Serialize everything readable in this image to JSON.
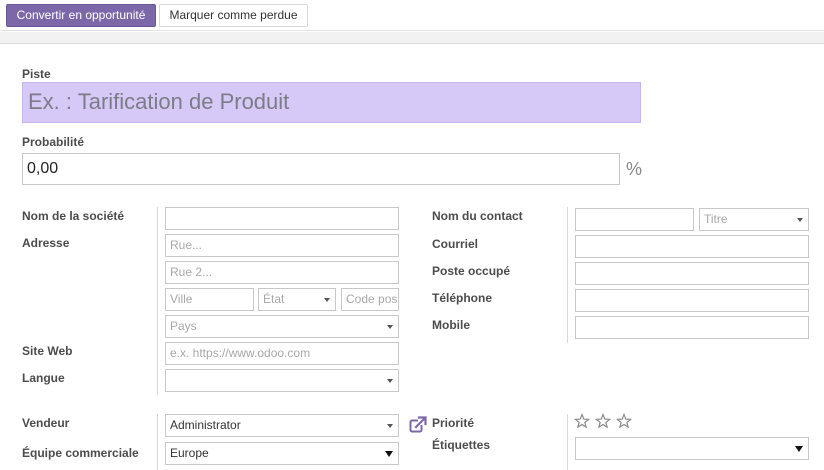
{
  "toolbar": {
    "convert_label": "Convertir en opportunité",
    "lost_label": "Marquer comme perdue"
  },
  "form": {
    "lead_label": "Piste",
    "lead_placeholder": "Ex. : Tarification de Produit",
    "probability_label": "Probabilité",
    "probability_value": "0,00",
    "percent_symbol": "%",
    "company_label": "Nom de la société",
    "company_value": "",
    "address_label": "Adresse",
    "street_placeholder": "Rue...",
    "street2_placeholder": "Rue 2...",
    "city_placeholder": "Ville",
    "state_placeholder": "État",
    "zip_placeholder": "Code pos",
    "country_placeholder": "Pays",
    "website_label": "Site Web",
    "website_placeholder": "e.x. https://www.odoo.com",
    "language_label": "Langue",
    "language_value": "",
    "contact_label": "Nom du contact",
    "contact_value": "",
    "title_placeholder": "Titre",
    "email_label": "Courriel",
    "job_label": "Poste occupé",
    "phone_label": "Téléphone",
    "mobile_label": "Mobile",
    "salesperson_label": "Vendeur",
    "salesperson_value": "Administrator",
    "sales_team_label": "Équipe commerciale",
    "sales_team_value": "Europe",
    "priority_label": "Priorité",
    "priority_stars": 0,
    "priority_max": 3,
    "tags_label": "Étiquettes",
    "tags_value": ""
  },
  "colors": {
    "primary_button": "#7c68a8",
    "lead_field_background": "#d6c9f8"
  },
  "icons": {
    "external_link": "external-link-icon",
    "priority": "star-outline-icon"
  }
}
